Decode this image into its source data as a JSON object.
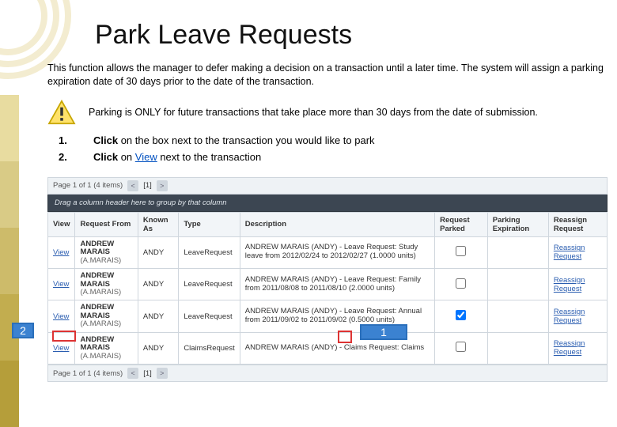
{
  "title": "Park Leave Requests",
  "intro": "This function allows the manager to defer making a decision on a transaction until a later time.  The system will assign a parking expiration date of 30 days prior to the date of the transaction.",
  "warning": "Parking is ONLY for future transactions that take place more than 30 days from the date of submission.",
  "steps": {
    "n1": "1.",
    "t1a": "Click",
    "t1b": " on the box next to the transaction you would like to park",
    "n2": "2.",
    "t2a": "Click",
    "t2b": " on ",
    "t2link": "View",
    "t2c": "  next to the transaction"
  },
  "grid": {
    "pager_top": "Page 1 of 1 (4 items)",
    "pager_bot": "Page 1 of 1 (4 items)",
    "pg_cur": "[1]",
    "group_hint": "Drag a column header here to group by that column",
    "headers": {
      "view": "View",
      "from": "Request From",
      "known": "Known As",
      "type": "Type",
      "desc": "Description",
      "parked": "Request Parked",
      "exp": "Parking Expiration",
      "reassign": "Reassign Request"
    },
    "rows": [
      {
        "view": "View",
        "from": "ANDREW MARAIS",
        "from2": "(A.MARAIS)",
        "known": "ANDY",
        "type": "LeaveRequest",
        "desc": "ANDREW MARAIS (ANDY) - Leave Request: Study leave from 2012/02/24 to 2012/02/27 (1.0000 units)",
        "parked": false,
        "exp": "",
        "reassign": "Reassign Request"
      },
      {
        "view": "View",
        "from": "ANDREW MARAIS",
        "from2": "(A.MARAIS)",
        "known": "ANDY",
        "type": "LeaveRequest",
        "desc": "ANDREW MARAIS (ANDY) - Leave Request: Family from 2011/08/08 to 2011/08/10 (2.0000 units)",
        "parked": false,
        "exp": "",
        "reassign": "Reassign Request"
      },
      {
        "view": "View",
        "from": "ANDREW MARAIS",
        "from2": "(A.MARAIS)",
        "known": "ANDY",
        "type": "LeaveRequest",
        "desc": "ANDREW MARAIS (ANDY) - Leave Request: Annual from 2011/09/02 to 2011/09/02 (0.5000 units)",
        "parked": true,
        "exp": "",
        "reassign": "Reassign Request"
      },
      {
        "view": "View",
        "from": "ANDREW MARAIS",
        "from2": "(A.MARAIS)",
        "known": "ANDY",
        "type": "ClaimsRequest",
        "desc": "ANDREW MARAIS (ANDY) - Claims Request: Claims",
        "parked": false,
        "exp": "",
        "reassign": "Reassign Request"
      }
    ]
  },
  "callouts": {
    "c1": "1",
    "c2": "2"
  }
}
